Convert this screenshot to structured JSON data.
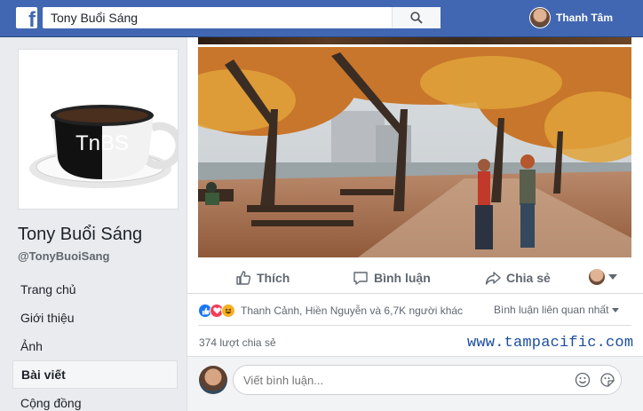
{
  "header": {
    "logo_letter": "f",
    "search_value": "Tony Buổi Sáng",
    "user_name": "Thanh Tâm"
  },
  "page": {
    "logo_text": "TnBS",
    "name": "Tony Buổi Sáng",
    "handle": "@TonyBuoiSang"
  },
  "nav": {
    "items": [
      {
        "label": "Trang chủ"
      },
      {
        "label": "Giới thiệu"
      },
      {
        "label": "Ảnh"
      },
      {
        "label": "Bài viết"
      },
      {
        "label": "Cộng đồng"
      }
    ],
    "active_index": 3
  },
  "post": {
    "actions": {
      "like": "Thích",
      "comment": "Bình luận",
      "share": "Chia sẻ"
    },
    "reactions": [
      "like",
      "love",
      "haha"
    ],
    "reaction_summary": "Thanh Cảnh, Hiền Nguyễn và 6,7K người khác",
    "comment_sort": "Bình luận liên quan nhất",
    "share_count": "374 lượt chia sẻ",
    "watermark": "www.tampacific.com",
    "comment_placeholder": "Viết bình luận..."
  },
  "colors": {
    "brand": "#4267b2",
    "like": "#1877f2",
    "love": "#f33e58",
    "haha": "#f7b125"
  }
}
